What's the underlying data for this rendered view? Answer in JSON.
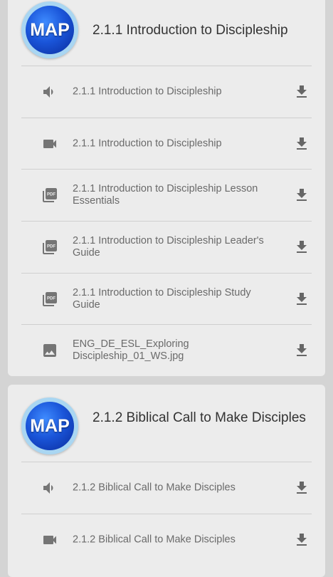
{
  "logo_text": "MAP",
  "sections": [
    {
      "title": "2.1.1 Introduction to Discipleship",
      "items": [
        {
          "icon": "audio-icon",
          "label": "2.1.1 Introduction to Discipleship"
        },
        {
          "icon": "video-icon",
          "label": "2.1.1 Introduction to Discipleship"
        },
        {
          "icon": "pdf-icon",
          "label": "2.1.1 Introduction to Discipleship Lesson Essentials"
        },
        {
          "icon": "pdf-icon",
          "label": "2.1.1 Introduction to Discipleship Leader's Guide"
        },
        {
          "icon": "pdf-icon",
          "label": "2.1.1 Introduction to Discipleship Study Guide"
        },
        {
          "icon": "image-icon",
          "label": "ENG_DE_ESL_Exploring Discipleship_01_WS.jpg"
        }
      ]
    },
    {
      "title": "2.1.2 Biblical Call to Make Disciples",
      "items": [
        {
          "icon": "audio-icon",
          "label": "2.1.2 Biblical Call to Make Disciples"
        },
        {
          "icon": "video-icon",
          "label": "2.1.2 Biblical Call to Make Disciples"
        }
      ]
    }
  ]
}
